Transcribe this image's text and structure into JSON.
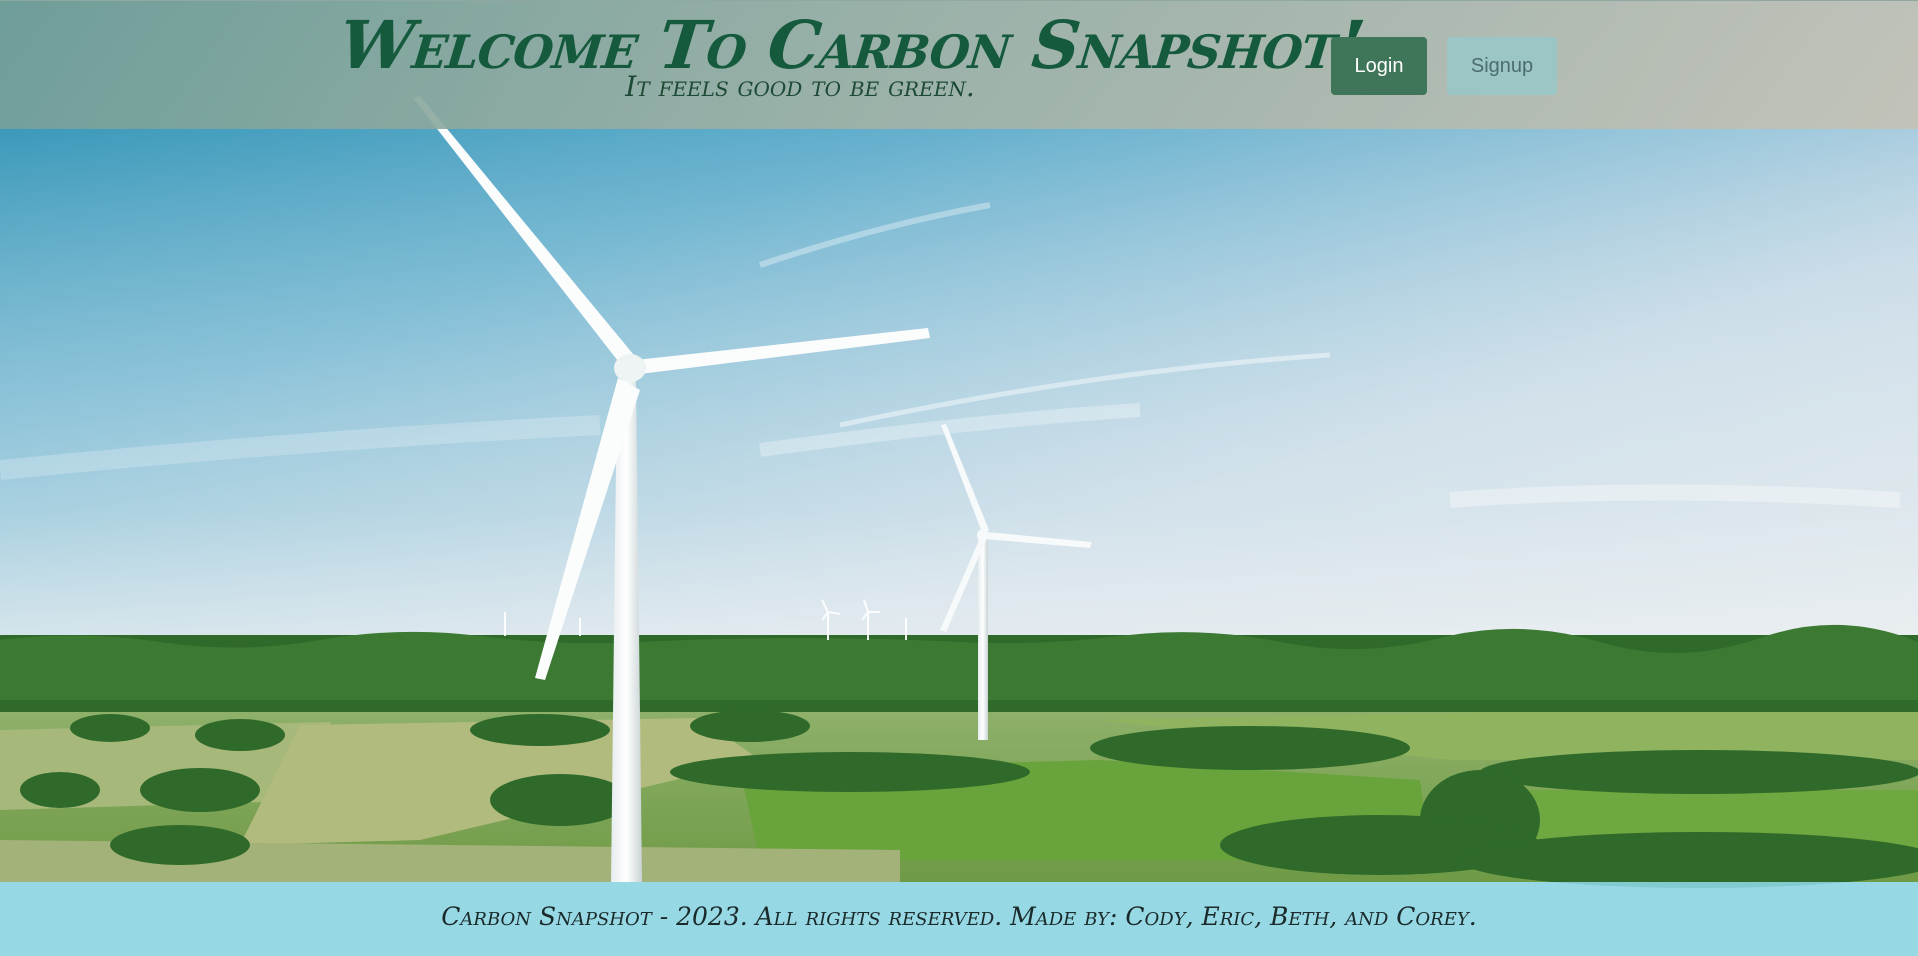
{
  "header": {
    "title": "Welcome To Carbon Snapshot!",
    "tagline": "It feels good to be green.",
    "login_label": "Login",
    "signup_label": "Signup"
  },
  "footer": {
    "text": "Carbon Snapshot - 2023. All rights reserved. Made by: Cody, Eric, Beth, and Corey."
  },
  "colors": {
    "title_green": "#165a3e",
    "login_bg": "#3f7558",
    "signup_bg": "#9cc6c6",
    "footer_bg": "#8cd4e2"
  }
}
